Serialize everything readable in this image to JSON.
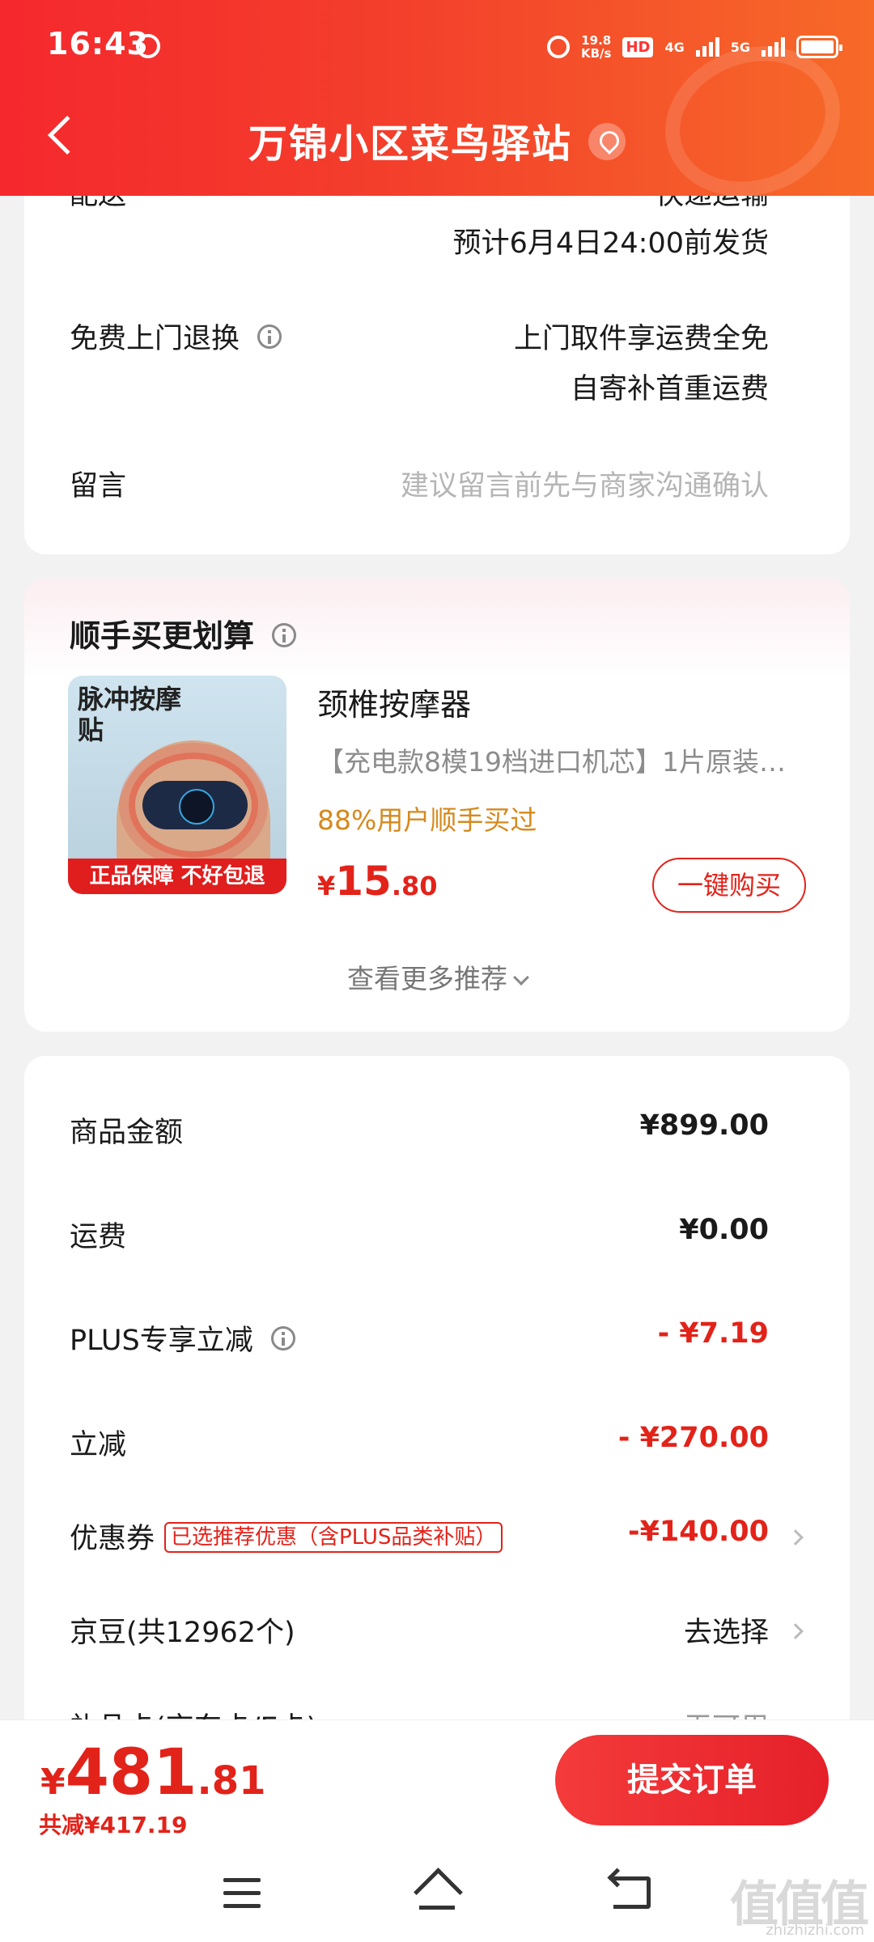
{
  "status_bar": {
    "time": "16:43",
    "net_speed_value": "19.8",
    "net_speed_unit": "KB/s",
    "hd_label": "HD",
    "net_4g": "4G",
    "net_5g": "5G"
  },
  "header": {
    "title": "万锦小区菜鸟驿站"
  },
  "delivery": {
    "partial_label": "配送",
    "partial_value": "快递运输",
    "ship_estimate": "预计6月4日24:00前发货"
  },
  "return_service": {
    "label": "免费上门退换",
    "line1": "上门取件享运费全免",
    "line2": "自寄补首重运费"
  },
  "message": {
    "label": "留言",
    "placeholder": "建议留言前先与商家沟通确认"
  },
  "recommend": {
    "title": "顺手买更划算",
    "image_text": "脉冲按摩贴",
    "image_banner": "正品保障 不好包退",
    "product_name": "颈椎按摩器",
    "product_desc": "【充电款8模19档进口机芯】1片原装…",
    "stat": "88%用户顺手买过",
    "price_symbol": "¥",
    "price_int": "15",
    "price_dec": ".80",
    "buy_label": "一键购买",
    "more_label": "查看更多推荐"
  },
  "summary": {
    "goods_label": "商品金额",
    "goods_value": "¥899.00",
    "shipping_label": "运费",
    "shipping_value": "¥0.00",
    "plus_label": "PLUS专享立减",
    "plus_value": "- ¥7.19",
    "discount_label": "立减",
    "discount_value": "- ¥270.00",
    "coupon_label": "优惠券",
    "coupon_tag": "已选推荐优惠（含PLUS品类补贴）",
    "coupon_value": "-¥140.00",
    "beans_label": "京豆(共12962个)",
    "beans_value": "去选择",
    "partial_row_label": "礼品卡(京东卡/E卡)",
    "partial_row_value": "无可用"
  },
  "bottom": {
    "total_symbol": "¥",
    "total_int": "481",
    "total_dec": ".81",
    "saved": "共减¥417.19",
    "submit_label": "提交订单"
  },
  "watermark": {
    "main": "值值值",
    "sub": "zhizhizhi.com"
  },
  "colors": {
    "accent": "#e2231a",
    "header_start": "#f5282d",
    "header_end": "#f76a28",
    "stat_orange": "#d6891d"
  }
}
